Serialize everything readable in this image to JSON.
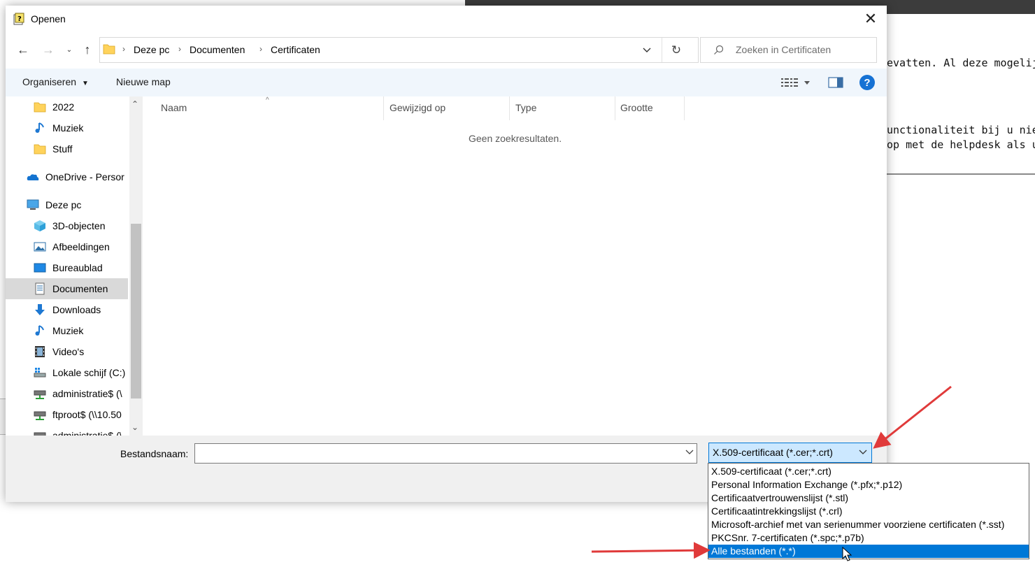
{
  "background_page": {
    "line1": "evatten. Al deze mogelijkh",
    "line2": "unctionaliteit bij u niet aa",
    "line3": "op met de helpdesk als u w"
  },
  "dialog": {
    "title": "Openen",
    "address": {
      "crumbs": [
        "Deze pc",
        "Documenten",
        "Certificaten"
      ]
    },
    "search": {
      "placeholder": "Zoeken in Certificaten"
    },
    "toolbar": {
      "organize": "Organiseren",
      "new_folder": "Nieuwe map",
      "help": "?"
    },
    "nav_items": [
      {
        "label": "2022",
        "icon": "folder-icon"
      },
      {
        "label": "Muziek",
        "icon": "music-icon"
      },
      {
        "label": "Stuff",
        "icon": "folder-icon"
      },
      {
        "label": "OneDrive - Persor",
        "icon": "onedrive-icon"
      },
      {
        "label": "Deze pc",
        "icon": "computer-icon"
      },
      {
        "label": "3D-objecten",
        "icon": "cube-icon"
      },
      {
        "label": "Afbeeldingen",
        "icon": "pictures-icon"
      },
      {
        "label": "Bureaublad",
        "icon": "desktop-icon"
      },
      {
        "label": "Documenten",
        "icon": "documents-icon",
        "selected": true
      },
      {
        "label": "Downloads",
        "icon": "download-icon"
      },
      {
        "label": "Muziek",
        "icon": "music-icon"
      },
      {
        "label": "Video's",
        "icon": "video-icon"
      },
      {
        "label": "Lokale schijf (C:)",
        "icon": "drive-icon"
      },
      {
        "label": "administratie$ (\\",
        "icon": "network-drive-icon"
      },
      {
        "label": "ftproot$ (\\\\10.50",
        "icon": "network-drive-icon"
      },
      {
        "label": "administratie$ (\\",
        "icon": "network-drive-icon"
      }
    ],
    "columns": [
      "Naam",
      "Gewijzigd op",
      "Type",
      "Grootte"
    ],
    "empty_message": "Geen zoekresultaten.",
    "filename_label": "Bestandsnaam:",
    "filename_value": "",
    "filetype_selected": "X.509-certificaat (*.cer;*.crt)",
    "filetype_options": [
      "X.509-certificaat (*.cer;*.crt)",
      "Personal Information Exchange (*.pfx;*.p12)",
      "Certificaatvertrouwenslijst (*.stl)",
      "Certificaatintrekkingslijst (*.crl)",
      "Microsoft-archief met van serienummer voorziene certificaten (*.sst)",
      "PKCSnr. 7-certificaten (*.spc;*.p7b)",
      "Alle bestanden (*.*)"
    ],
    "highlighted_option_index": 6
  },
  "colors": {
    "accent": "#0078d7",
    "annotation_arrow": "#e03a3a",
    "toolbar_bg": "#f0f6fc",
    "selection_bg": "#cce8ff"
  }
}
